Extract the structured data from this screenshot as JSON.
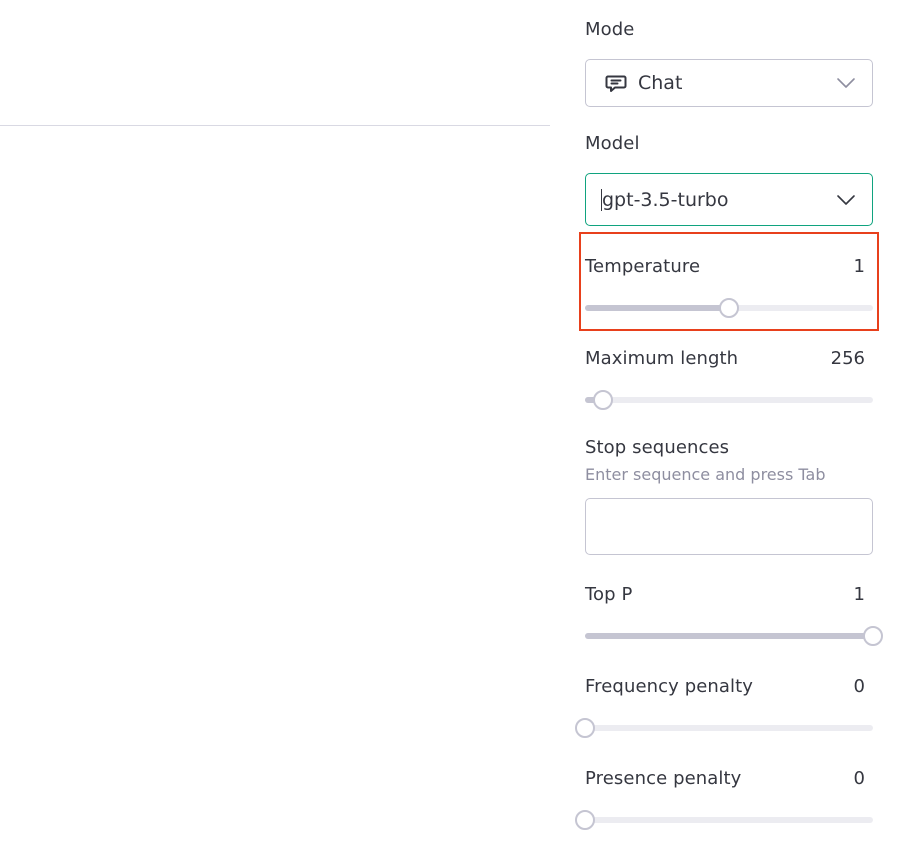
{
  "main": {
    "divider": true
  },
  "settings": {
    "mode": {
      "label": "Mode",
      "selected": "Chat",
      "icon": "chat-bubble-icon"
    },
    "model": {
      "label": "Model",
      "selected": "gpt-3.5-turbo",
      "focused": true
    },
    "temperature": {
      "label": "Temperature",
      "value": "1",
      "fraction": 0.5,
      "highlighted": true
    },
    "maximum_length": {
      "label": "Maximum length",
      "value": "256",
      "fraction": 0.0625
    },
    "stop_sequences": {
      "label": "Stop sequences",
      "hint": "Enter sequence and press Tab",
      "value": ""
    },
    "top_p": {
      "label": "Top P",
      "value": "1",
      "fraction": 1.0
    },
    "frequency_penalty": {
      "label": "Frequency penalty",
      "value": "0",
      "fraction": 0.0
    },
    "presence_penalty": {
      "label": "Presence penalty",
      "value": "0",
      "fraction": 0.0
    }
  },
  "colors": {
    "accent_focus": "#10a37f",
    "highlight": "#e8401c",
    "track": "#ececf1",
    "track_fill": "#c5c5d2"
  }
}
